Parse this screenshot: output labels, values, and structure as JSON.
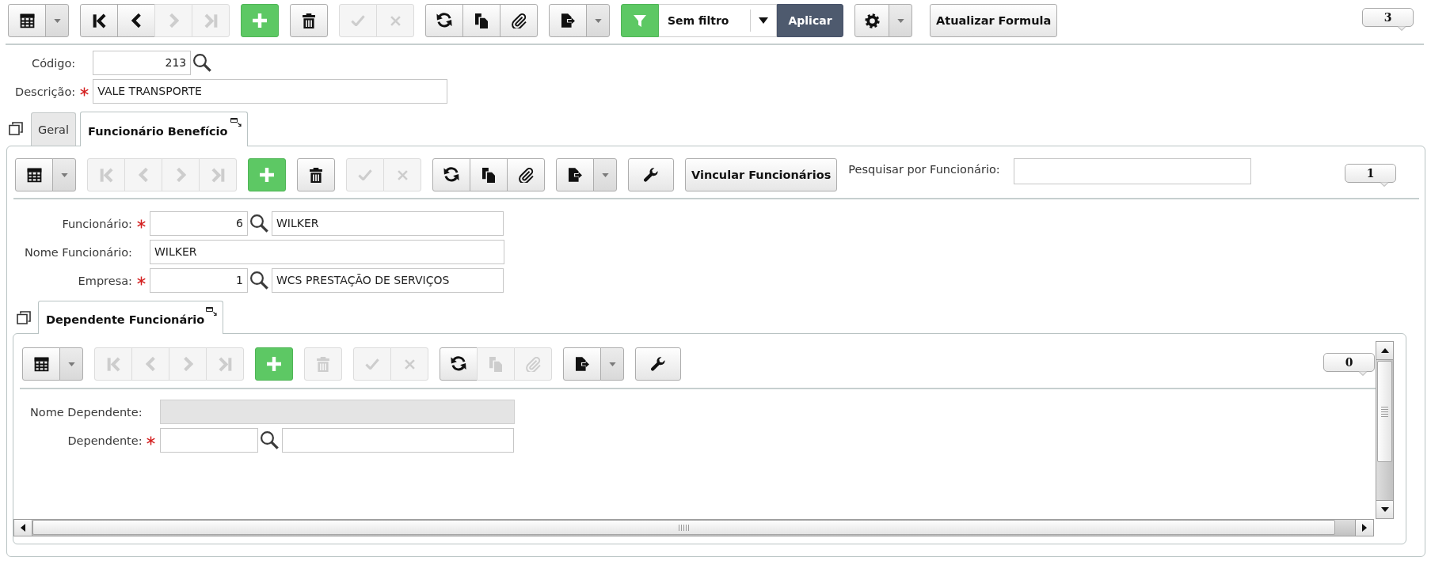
{
  "toolbar": {
    "items": [
      {
        "kind": "group",
        "buttons": [
          {
            "kind": "grid",
            "disabled": false
          },
          {
            "kind": "menu",
            "disabled": false
          }
        ]
      },
      {
        "kind": "group",
        "buttons": [
          {
            "kind": "first",
            "disabled": false
          },
          {
            "kind": "previous",
            "disabled": false
          },
          {
            "kind": "next",
            "disabled": true
          },
          {
            "kind": "last",
            "disabled": true
          }
        ]
      },
      {
        "kind": "group",
        "buttons": [
          {
            "kind": "add",
            "disabled": false
          }
        ]
      },
      {
        "kind": "group",
        "buttons": [
          {
            "kind": "delete",
            "disabled": false
          }
        ]
      },
      {
        "kind": "group",
        "buttons": [
          {
            "kind": "save",
            "disabled": true
          },
          {
            "kind": "cancel",
            "disabled": true
          }
        ]
      },
      {
        "kind": "group",
        "buttons": [
          {
            "kind": "refresh",
            "disabled": false
          },
          {
            "kind": "copy",
            "disabled": false
          },
          {
            "kind": "attach",
            "disabled": false
          }
        ]
      },
      {
        "kind": "group",
        "buttons": [
          {
            "kind": "export",
            "disabled": false
          },
          {
            "kind": "menu",
            "disabled": false
          }
        ]
      },
      {
        "kind": "filter",
        "value": "Sem filtro",
        "apply": "Aplicar"
      },
      {
        "kind": "group",
        "buttons": [
          {
            "kind": "settings",
            "disabled": false
          },
          {
            "kind": "menu",
            "disabled": false
          }
        ]
      },
      {
        "kind": "text_button",
        "label": "Atualizar Formula"
      }
    ],
    "record_count": "3"
  },
  "form": {
    "fields": [
      {
        "kind": "code",
        "label": "Código:",
        "required": false,
        "disabled": false,
        "code": "213"
      },
      {
        "kind": "text",
        "label": "Descrição:",
        "required": true,
        "disabled": false,
        "value": "VALE TRANSPORTE"
      }
    ]
  },
  "tabs": [
    {
      "label": "Geral",
      "selected": false
    },
    {
      "label": "Funcionário Benefício",
      "selected": true
    }
  ],
  "detail": {
    "toolbar": {
      "items": [
        {
          "kind": "group",
          "buttons": [
            {
              "kind": "grid",
              "disabled": false
            },
            {
              "kind": "menu",
              "disabled": false
            }
          ]
        },
        {
          "kind": "group",
          "buttons": [
            {
              "kind": "first",
              "disabled": true
            },
            {
              "kind": "previous",
              "disabled": true
            },
            {
              "kind": "next",
              "disabled": true
            },
            {
              "kind": "last",
              "disabled": true
            }
          ]
        },
        {
          "kind": "group",
          "buttons": [
            {
              "kind": "add",
              "disabled": false
            }
          ]
        },
        {
          "kind": "group",
          "buttons": [
            {
              "kind": "delete",
              "disabled": false
            }
          ]
        },
        {
          "kind": "group",
          "buttons": [
            {
              "kind": "save",
              "disabled": true
            },
            {
              "kind": "cancel",
              "disabled": true
            }
          ]
        },
        {
          "kind": "group",
          "buttons": [
            {
              "kind": "refresh",
              "disabled": false
            },
            {
              "kind": "copy",
              "disabled": false
            },
            {
              "kind": "attach",
              "disabled": false
            }
          ]
        },
        {
          "kind": "group",
          "buttons": [
            {
              "kind": "export",
              "disabled": false
            },
            {
              "kind": "menu",
              "disabled": false
            }
          ]
        },
        {
          "kind": "group",
          "buttons": [
            {
              "kind": "wrench",
              "disabled": false
            }
          ]
        },
        {
          "kind": "text_button",
          "label": "Vincular Funcionários"
        },
        {
          "kind": "search",
          "label": "Pesquisar por Funcionário:"
        }
      ],
      "record_count": "1"
    },
    "form": {
      "fields": [
        {
          "kind": "lookup",
          "label": "Funcionário:",
          "required": true,
          "disabled": false,
          "code": "6",
          "name": "WILKER"
        },
        {
          "kind": "text",
          "label": "Nome Funcionário:",
          "required": false,
          "disabled": false,
          "value": "WILKER"
        },
        {
          "kind": "lookup",
          "label": "Empresa:",
          "required": true,
          "disabled": false,
          "code": "1",
          "name": "WCS PRESTAÇÃO DE SERVIÇOS"
        }
      ]
    },
    "tabs": [
      {
        "label": "Dependente Funcionário",
        "selected": true
      }
    ],
    "dependents": {
      "toolbar": {
        "items": [
          {
            "kind": "group",
            "buttons": [
              {
                "kind": "grid",
                "disabled": false
              },
              {
                "kind": "menu",
                "disabled": false
              }
            ]
          },
          {
            "kind": "group",
            "buttons": [
              {
                "kind": "first",
                "disabled": true
              },
              {
                "kind": "previous",
                "disabled": true
              },
              {
                "kind": "next",
                "disabled": true
              },
              {
                "kind": "last",
                "disabled": true
              }
            ]
          },
          {
            "kind": "group",
            "buttons": [
              {
                "kind": "add",
                "disabled": false
              }
            ]
          },
          {
            "kind": "group",
            "buttons": [
              {
                "kind": "delete",
                "disabled": true
              }
            ]
          },
          {
            "kind": "group",
            "buttons": [
              {
                "kind": "save",
                "disabled": true
              },
              {
                "kind": "cancel",
                "disabled": true
              }
            ]
          },
          {
            "kind": "group",
            "buttons": [
              {
                "kind": "refresh",
                "disabled": false
              },
              {
                "kind": "copy",
                "disabled": true
              },
              {
                "kind": "attach",
                "disabled": true
              }
            ]
          },
          {
            "kind": "group",
            "buttons": [
              {
                "kind": "export",
                "disabled": false
              },
              {
                "kind": "menu",
                "disabled": false
              }
            ]
          },
          {
            "kind": "group",
            "buttons": [
              {
                "kind": "wrench",
                "disabled": false
              }
            ]
          }
        ],
        "record_count": "0"
      },
      "form": {
        "fields": [
          {
            "kind": "text",
            "label": "Nome Dependente:",
            "required": false,
            "disabled": true
          },
          {
            "kind": "lookup",
            "label": "Dependente:",
            "required": true,
            "disabled": false
          }
        ]
      }
    }
  }
}
